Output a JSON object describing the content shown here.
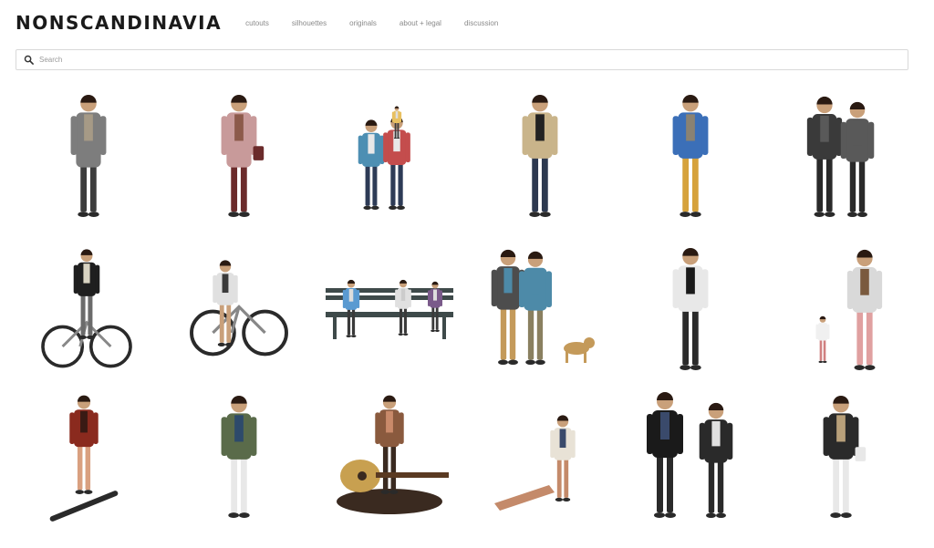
{
  "site": {
    "title": "NONSCANDINAVIA"
  },
  "nav": [
    {
      "label": "cutouts"
    },
    {
      "label": "silhouettes"
    },
    {
      "label": "originals"
    },
    {
      "label": "about + legal"
    },
    {
      "label": "discussion"
    }
  ],
  "search": {
    "placeholder": "Search",
    "value": ""
  },
  "gallery": {
    "items": [
      {
        "name": "cutout-woman-grey-coat-walking",
        "colors": [
          "#7d7d7d",
          "#a69a86",
          "#3d3d3d"
        ]
      },
      {
        "name": "cutout-woman-pink-coat-bag",
        "colors": [
          "#c89a9a",
          "#8c5a4a",
          "#6b2b2b"
        ]
      },
      {
        "name": "cutout-couple-with-child-on-shoulders",
        "colors": [
          "#4d8fb3",
          "#c44d4d",
          "#2d3b56"
        ]
      },
      {
        "name": "cutout-man-beige-jacket",
        "colors": [
          "#c9b48a",
          "#222222",
          "#2d3950"
        ]
      },
      {
        "name": "cutout-boy-blue-jacket-skateboard",
        "colors": [
          "#3b6fb8",
          "#8a8272",
          "#d6a23c"
        ]
      },
      {
        "name": "cutout-couple-walking-away",
        "colors": [
          "#3a3a3a",
          "#595959",
          "#2a2a2a"
        ]
      },
      {
        "name": "cutout-woman-on-bicycle",
        "colors": [
          "#1f1f1f",
          "#d9d3c2",
          "#6b6b6b"
        ]
      },
      {
        "name": "cutout-man-wheelie-bicycle",
        "colors": [
          "#e0e0e0",
          "#3a3a3a",
          "#c9a07a"
        ]
      },
      {
        "name": "cutout-people-on-park-bench",
        "colors": [
          "#3e4a4a",
          "#5a9ad1",
          "#7a5a8a"
        ]
      },
      {
        "name": "cutout-couple-with-dog",
        "colors": [
          "#4d4d4d",
          "#4d8aa8",
          "#c49a5a"
        ]
      },
      {
        "name": "cutout-man-white-shirt-tie",
        "colors": [
          "#e8e8e8",
          "#1a1a1a",
          "#2b2b2b"
        ]
      },
      {
        "name": "cutout-father-with-toddler",
        "colors": [
          "#d9d9d9",
          "#7a5a3e",
          "#e0a0a0"
        ]
      },
      {
        "name": "cutout-skateboarder-jumping",
        "colors": [
          "#8a2a1e",
          "#3a1a14",
          "#d9a080"
        ]
      },
      {
        "name": "cutout-man-camo-jacket",
        "colors": [
          "#5a6b4a",
          "#2d4a6b",
          "#e8e8e8"
        ]
      },
      {
        "name": "cutout-woman-with-guitar",
        "colors": [
          "#c8a050",
          "#3a2a20",
          "#8a5a3e"
        ]
      },
      {
        "name": "cutout-woman-sitting-reading",
        "colors": [
          "#e8e2d6",
          "#3a4a6b",
          "#c48a6a"
        ]
      },
      {
        "name": "cutout-two-women-walking",
        "colors": [
          "#1a1a1a",
          "#3a4a6b",
          "#2a2a2a"
        ]
      },
      {
        "name": "cutout-man-with-backpack",
        "colors": [
          "#2a2a2a",
          "#b8a07a",
          "#e8e8e8"
        ]
      }
    ]
  }
}
